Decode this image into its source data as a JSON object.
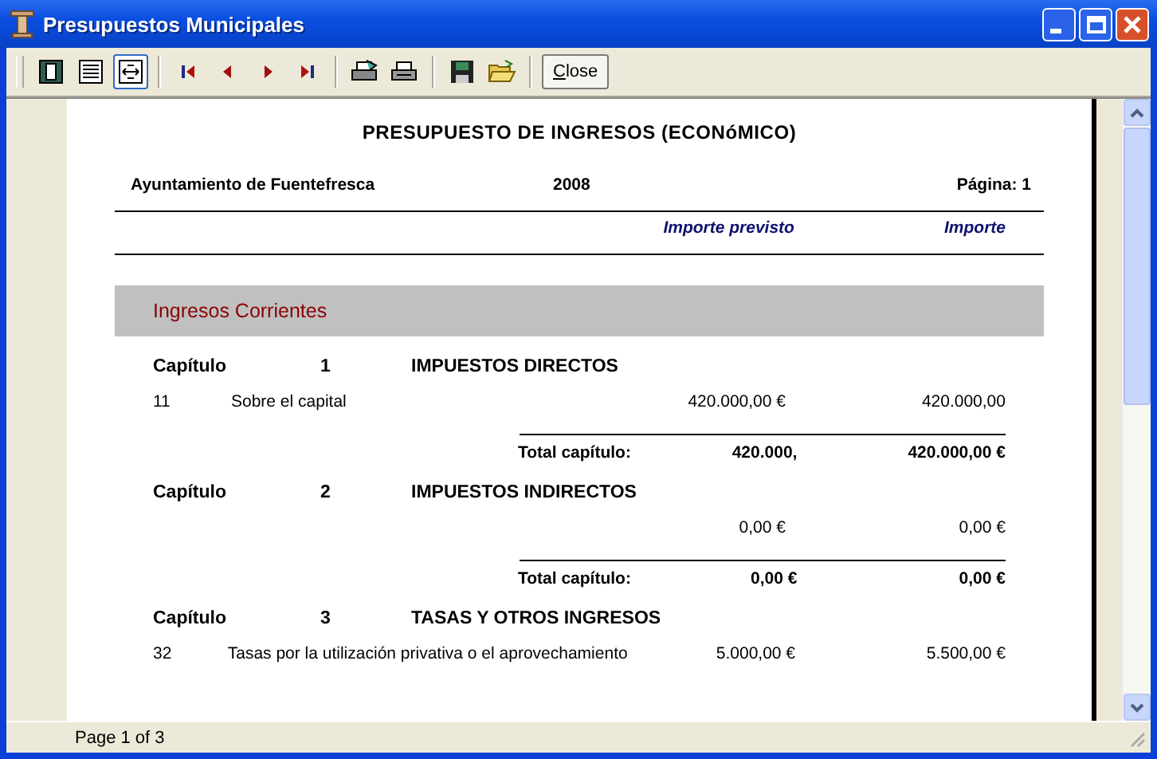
{
  "window": {
    "title": "Presupuestos Municipales"
  },
  "toolbar": {
    "view_modes": [
      {
        "selected": false
      },
      {
        "selected": false
      },
      {
        "selected": true
      }
    ],
    "close_button": "Close"
  },
  "report": {
    "title": "PRESUPUESTO DE INGRESOS (ECONóMICO)",
    "header": {
      "entity": "Ayuntamiento de Fuentefresca",
      "year": "2008",
      "page": "Página: 1"
    },
    "column_headings": [
      "Importe previsto",
      "Importe"
    ],
    "section": "Ingresos Corrientes",
    "chapters": [
      {
        "label": "Capítulo",
        "number": "1",
        "name": "IMPUESTOS DIRECTOS",
        "rows": [
          {
            "code": "11",
            "description": "Sobre el capital",
            "budgeted": "420.000,00 €",
            "actual": "420.000,00"
          }
        ],
        "total": {
          "label": "Total capítulo:",
          "budgeted": "420.000,",
          "actual": "420.000,00 €"
        }
      },
      {
        "label": "Capítulo",
        "number": "2",
        "name": "IMPUESTOS INDIRECTOS",
        "rows": [
          {
            "budgeted": "0,00 €",
            "actual": "0,00 €"
          }
        ],
        "total": {
          "label": "Total capítulo:",
          "budgeted": "0,00 €",
          "actual": "0,00 €"
        }
      },
      {
        "label": "Capítulo",
        "number": "3",
        "name": "TASAS Y OTROS INGRESOS",
        "rows": [
          {
            "code": "32",
            "description": "Tasas por la utilización privativa o el aprovechamiento",
            "budgeted": "5.000,00 €",
            "actual": "5.500,00 €"
          }
        ]
      }
    ]
  },
  "status_bar": {
    "text": "Page 1 of 3"
  }
}
